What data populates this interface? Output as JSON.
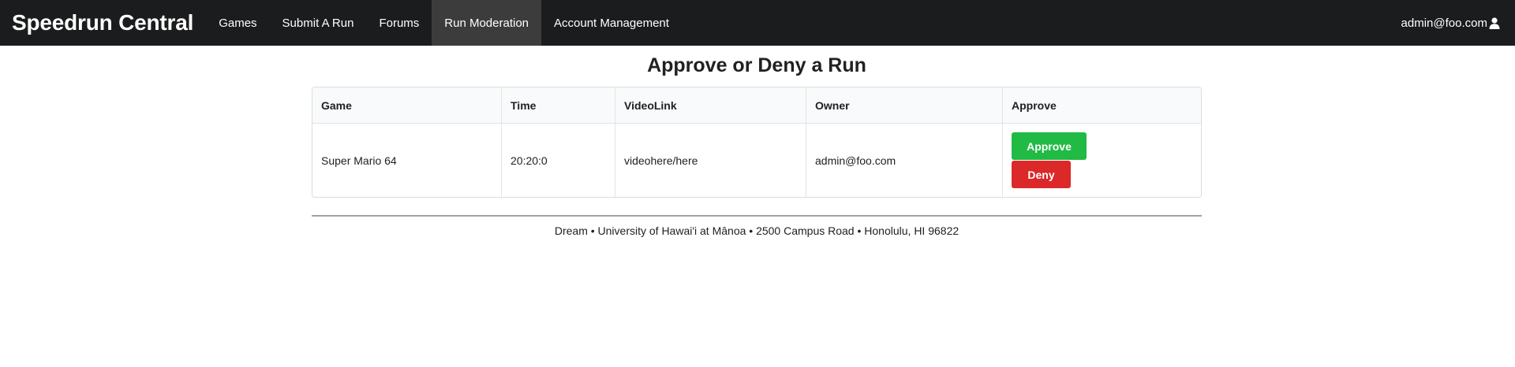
{
  "navbar": {
    "brand": "Speedrun Central",
    "items": [
      {
        "label": "Games",
        "active": false
      },
      {
        "label": "Submit A Run",
        "active": false
      },
      {
        "label": "Forums",
        "active": false
      },
      {
        "label": "Run Moderation",
        "active": true
      },
      {
        "label": "Account Management",
        "active": false
      }
    ],
    "user": {
      "email": "admin@foo.com",
      "icon": "user-icon"
    }
  },
  "main": {
    "title": "Approve or Deny a Run",
    "table": {
      "columns": [
        "Game",
        "Time",
        "VideoLink",
        "Owner",
        "Approve"
      ],
      "rows": [
        {
          "game": "Super Mario 64",
          "time": "20:20:0",
          "video_link": "videohere/here",
          "owner": "admin@foo.com",
          "approve_label": "Approve",
          "deny_label": "Deny"
        }
      ]
    }
  },
  "footer": {
    "text": "Dream • University of Hawai'i at Mânoa • 2500 Campus Road • Honolulu, HI 96822"
  },
  "colors": {
    "navbar_bg": "#1b1c1d",
    "nav_active_bg": "#3c3c3c",
    "approve_green": "#21ba45",
    "deny_red": "#db2828"
  }
}
